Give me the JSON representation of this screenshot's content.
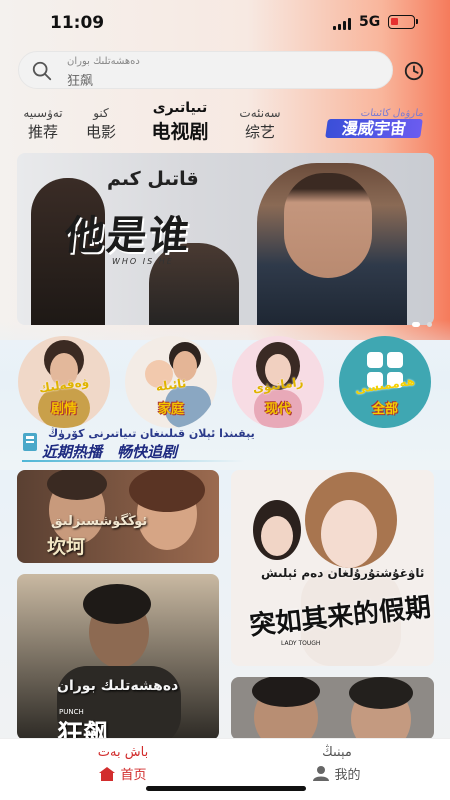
{
  "status": {
    "time": "11:09",
    "network": "5G"
  },
  "search": {
    "hint": "دەھشەتلىك بوران",
    "value": "狂飙"
  },
  "tabs": [
    {
      "ug": "تەۋسىيە",
      "cn": "推荐"
    },
    {
      "ug": "كنو",
      "cn": "电影"
    },
    {
      "ug": "تىياتىرى",
      "cn": "电视剧",
      "active": true
    },
    {
      "ug": "سەنئەت",
      "cn": "综艺"
    }
  ],
  "marvel": {
    "ug": "مارۋەل كائىنات",
    "cn": "漫威宇宙"
  },
  "banner": {
    "ug": "قاتىل كىم",
    "cn": "他是谁",
    "en": "WHO IS HE"
  },
  "genres": [
    {
      "ug": "ۋەقەلىك",
      "cn": "剧情"
    },
    {
      "ug": "ئائىلە",
      "cn": "家庭"
    },
    {
      "ug": "زامانىۋى",
      "cn": "现代"
    },
    {
      "ug": "ھەممىسى",
      "cn": "全部"
    }
  ],
  "hot": {
    "ug": "يېقىندا ئېلان قىلىنغان تىياتىرنى كۆرۈڭ",
    "cn": "近期热播　畅快追剧"
  },
  "posters": [
    {
      "ug": "ئوڭگۈشسىزلىق",
      "cn": "坎坷"
    },
    {
      "ug": "ئاۋغۇشتۇرۇلغان دەم ئېلىش",
      "cn": "突如其来的假期",
      "en": "LADY TOUGH"
    },
    {
      "ug": "دەھشەتلىك بوران",
      "cn": "狂飙",
      "en": "PUNCH"
    },
    {
      "ug": "",
      "cn": ""
    }
  ],
  "nav": {
    "home": {
      "ug": "باش بەت",
      "cn": "首页"
    },
    "mine": {
      "ug": "مېنىڭ",
      "cn": "我的"
    }
  },
  "colors": {
    "accent": "#d22d2d",
    "tab_active": "#111111",
    "genre_text": "#f4c400"
  }
}
